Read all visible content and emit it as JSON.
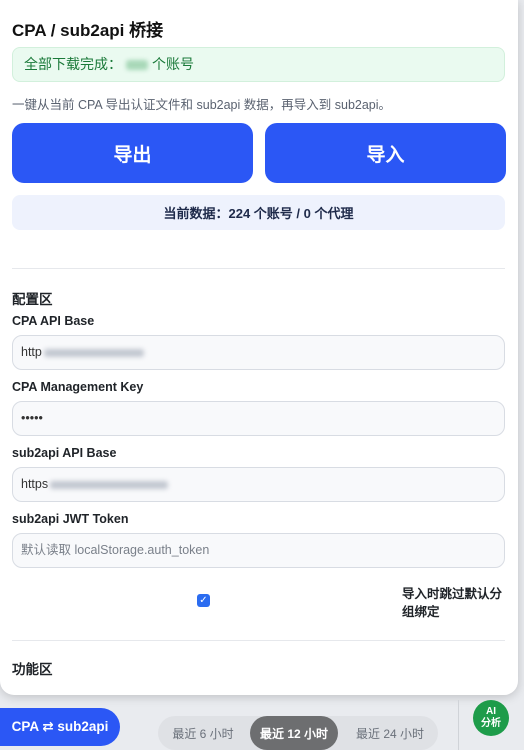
{
  "panel": {
    "title": "CPA / sub2api 桥接",
    "success_prefix": "全部下载完成：",
    "success_suffix": "个账号",
    "description": "一键从当前 CPA 导出认证文件和 sub2api 数据，再导入到 sub2api。",
    "export_label": "导出",
    "import_label": "导入",
    "current_data": "当前数据：224 个账号 / 0 个代理"
  },
  "config": {
    "section_title": "配置区",
    "cpa_api_base_label": "CPA API Base",
    "cpa_api_base_value": "http",
    "cpa_management_key_label": "CPA Management Key",
    "cpa_management_key_value": "•••••",
    "sub2api_base_label": "sub2api API Base",
    "sub2api_base_value": "https",
    "jwt_label": "sub2api JWT Token",
    "jwt_placeholder": "默认读取 localStorage.auth_token",
    "skip_group_label": "导入时跳过默认分组绑定",
    "skip_group_checked": true
  },
  "functions": {
    "section_title": "功能区"
  },
  "footer": {
    "toggle_label": "CPA ⇄ sub2api",
    "ranges": [
      "最近 6 小时",
      "最近 12 小时",
      "最近 24 小时"
    ],
    "active_range": "最近 12 小时",
    "ai_line1": "AI",
    "ai_line2": "分析"
  },
  "colors": {
    "primary": "#2b57f5",
    "success_bg": "#eafaf0",
    "success_text": "#1b7a3a",
    "ai_badge": "#1e9c4a"
  }
}
